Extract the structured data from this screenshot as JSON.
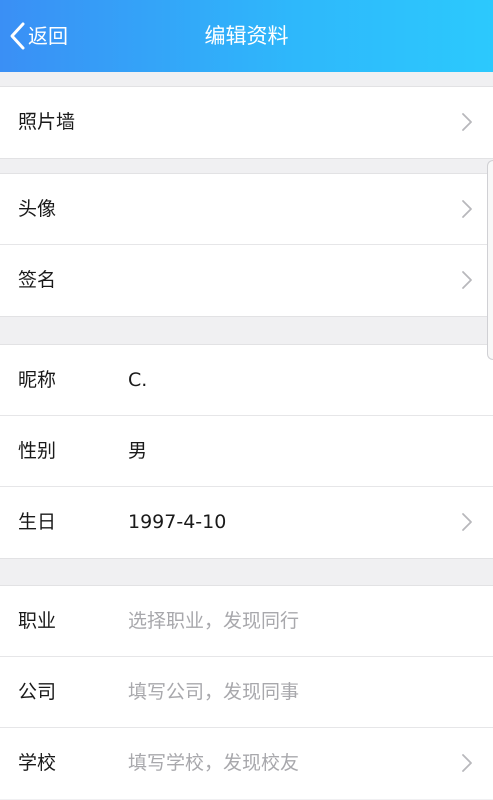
{
  "header": {
    "back_label": "返回",
    "title": "编辑资料",
    "gradient_start": "#3a8ff5",
    "gradient_end": "#2cc9fd"
  },
  "groups": [
    {
      "rows": [
        {
          "label": "照片墙",
          "value": "",
          "chevron": true
        }
      ]
    },
    {
      "rows": [
        {
          "label": "头像",
          "value": "",
          "chevron": true
        },
        {
          "label": "签名",
          "value": "",
          "chevron": true
        }
      ]
    },
    {
      "rows": [
        {
          "label": "昵称",
          "value": "C.",
          "chevron": false
        },
        {
          "label": "性别",
          "value": "男",
          "chevron": false
        },
        {
          "label": "生日",
          "value": "1997-4-10",
          "chevron": true
        }
      ]
    },
    {
      "rows": [
        {
          "label": "职业",
          "placeholder": "选择职业，发现同行",
          "chevron": false
        },
        {
          "label": "公司",
          "placeholder": "填写公司，发现同事",
          "chevron": false
        },
        {
          "label": "学校",
          "placeholder": "填写学校，发现校友",
          "chevron": true
        }
      ]
    }
  ],
  "icons": {
    "back": "chevron-left-icon",
    "row_arrow": "chevron-right-icon"
  }
}
